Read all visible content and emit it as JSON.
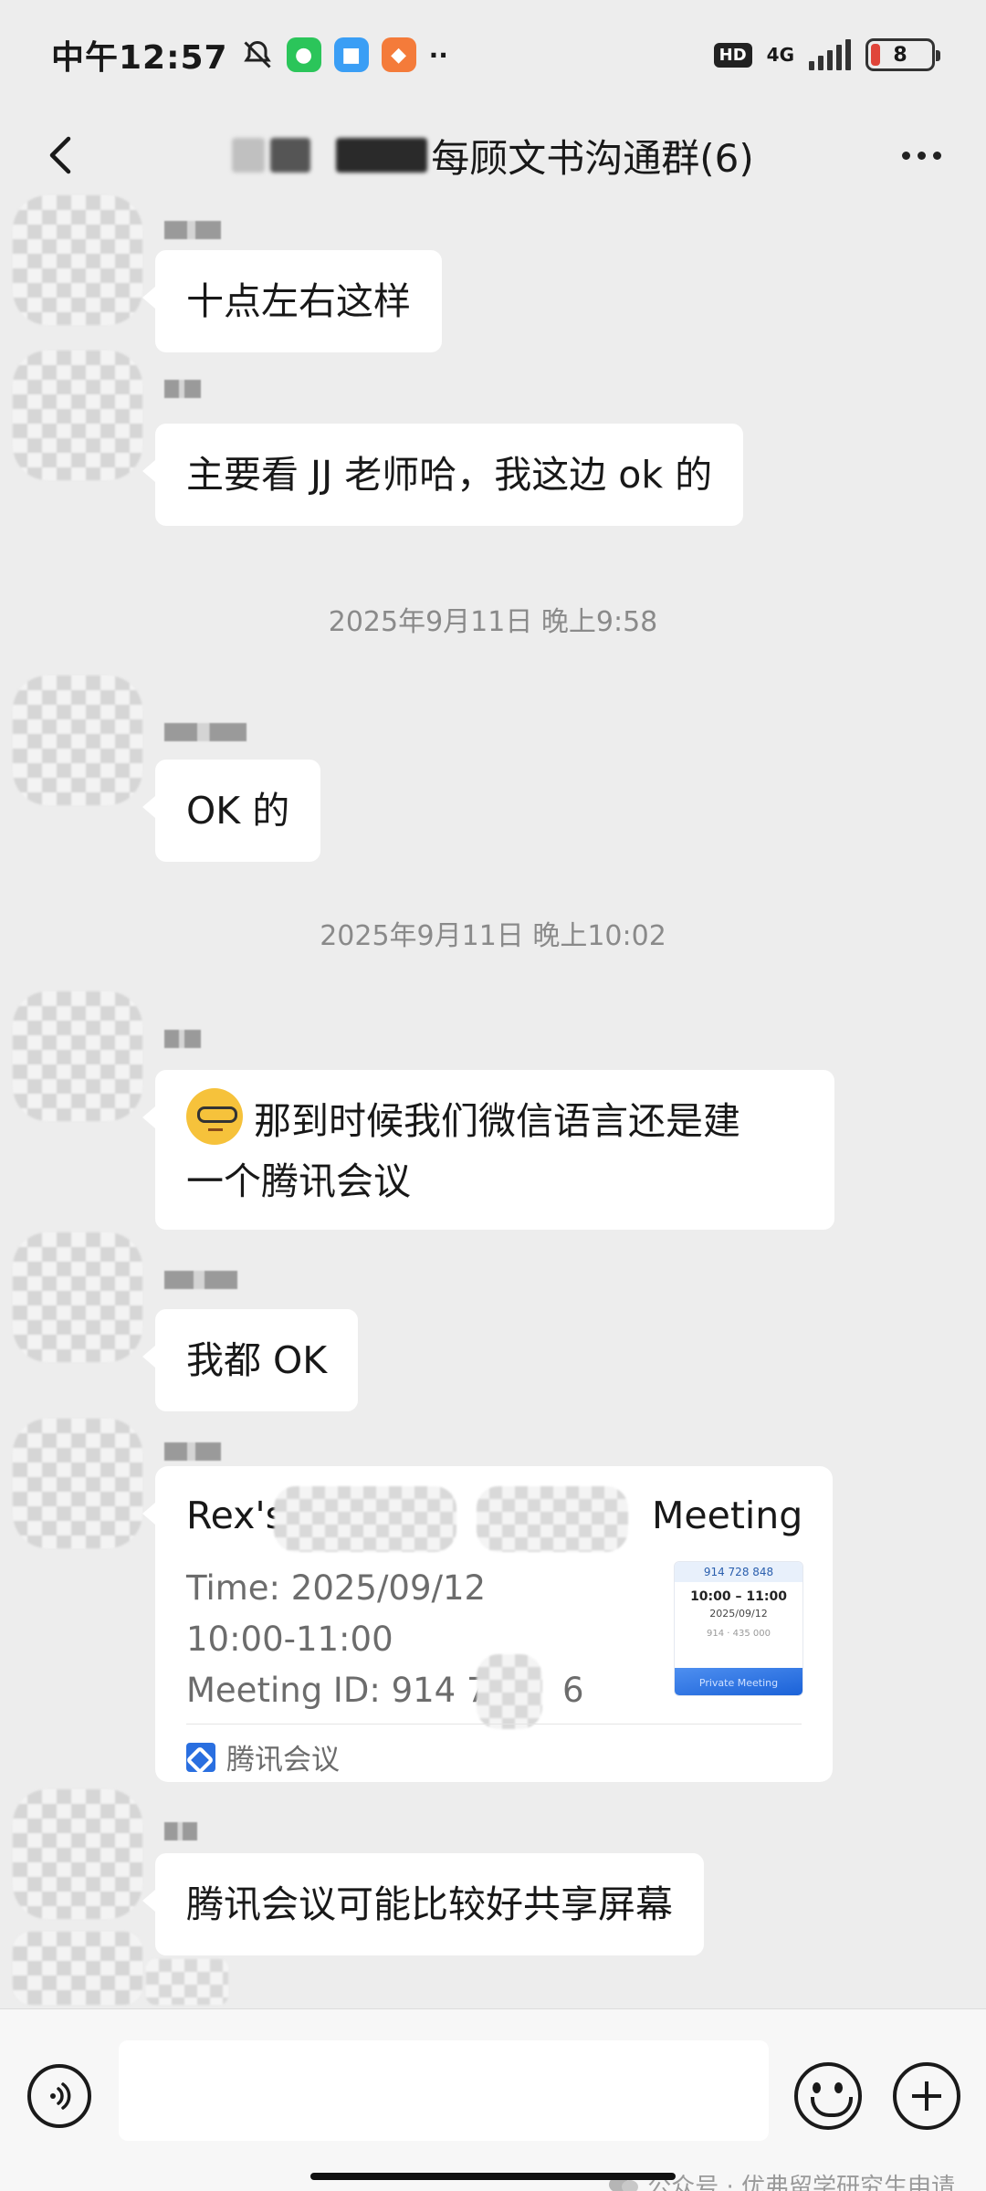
{
  "status_bar": {
    "time": "中午12:57",
    "hd": "HD",
    "network": "4G",
    "battery": "8",
    "more_indicator": "··",
    "icons": [
      "bell-off-icon",
      "wechat-icon",
      "app-icon",
      "taobao-icon"
    ]
  },
  "header": {
    "title": "每顾文书沟通群(6)",
    "back_icon": "chevron-left-icon",
    "more_icon": "more-icon"
  },
  "messages": [
    {
      "type": "text",
      "text": "十点左右这样"
    },
    {
      "type": "text",
      "text": "主要看 JJ 老师哈，我这边 ok 的"
    },
    {
      "type": "time",
      "text": "2025年9月11日 晚上9:58"
    },
    {
      "type": "text",
      "text": "OK 的"
    },
    {
      "type": "time",
      "text": "2025年9月11日 晚上10:02"
    },
    {
      "type": "text",
      "text_line1": "那到时候我们微信语言还是建",
      "text_line2": "一个腾讯会议",
      "emoji": "nerd-face-emoji"
    },
    {
      "type": "text",
      "text": "我都 OK"
    },
    {
      "type": "meeting_card",
      "title_start": "Rex's",
      "title_end": "Meeting",
      "time": "Time: 2025/09/12",
      "time_range": "10:00-11:00",
      "meeting_id": "Meeting ID: 914 72",
      "meeting_id_end": "6",
      "app_name": "腾讯会议",
      "thumb": {
        "id": "914 728 848",
        "time": "10:00 – 11:00",
        "date": "2025/09/12",
        "id_blur": "914 · 435 000",
        "label": "Private Meeting"
      }
    },
    {
      "type": "text",
      "text": "腾讯会议可能比较好共享屏幕"
    }
  ],
  "input_bar": {
    "placeholder": "",
    "voice_icon": "voice-icon",
    "emoji_icon": "emoji-icon",
    "plus_icon": "plus-icon"
  },
  "watermark": "公众号 · 优弗留学研究生申请"
}
